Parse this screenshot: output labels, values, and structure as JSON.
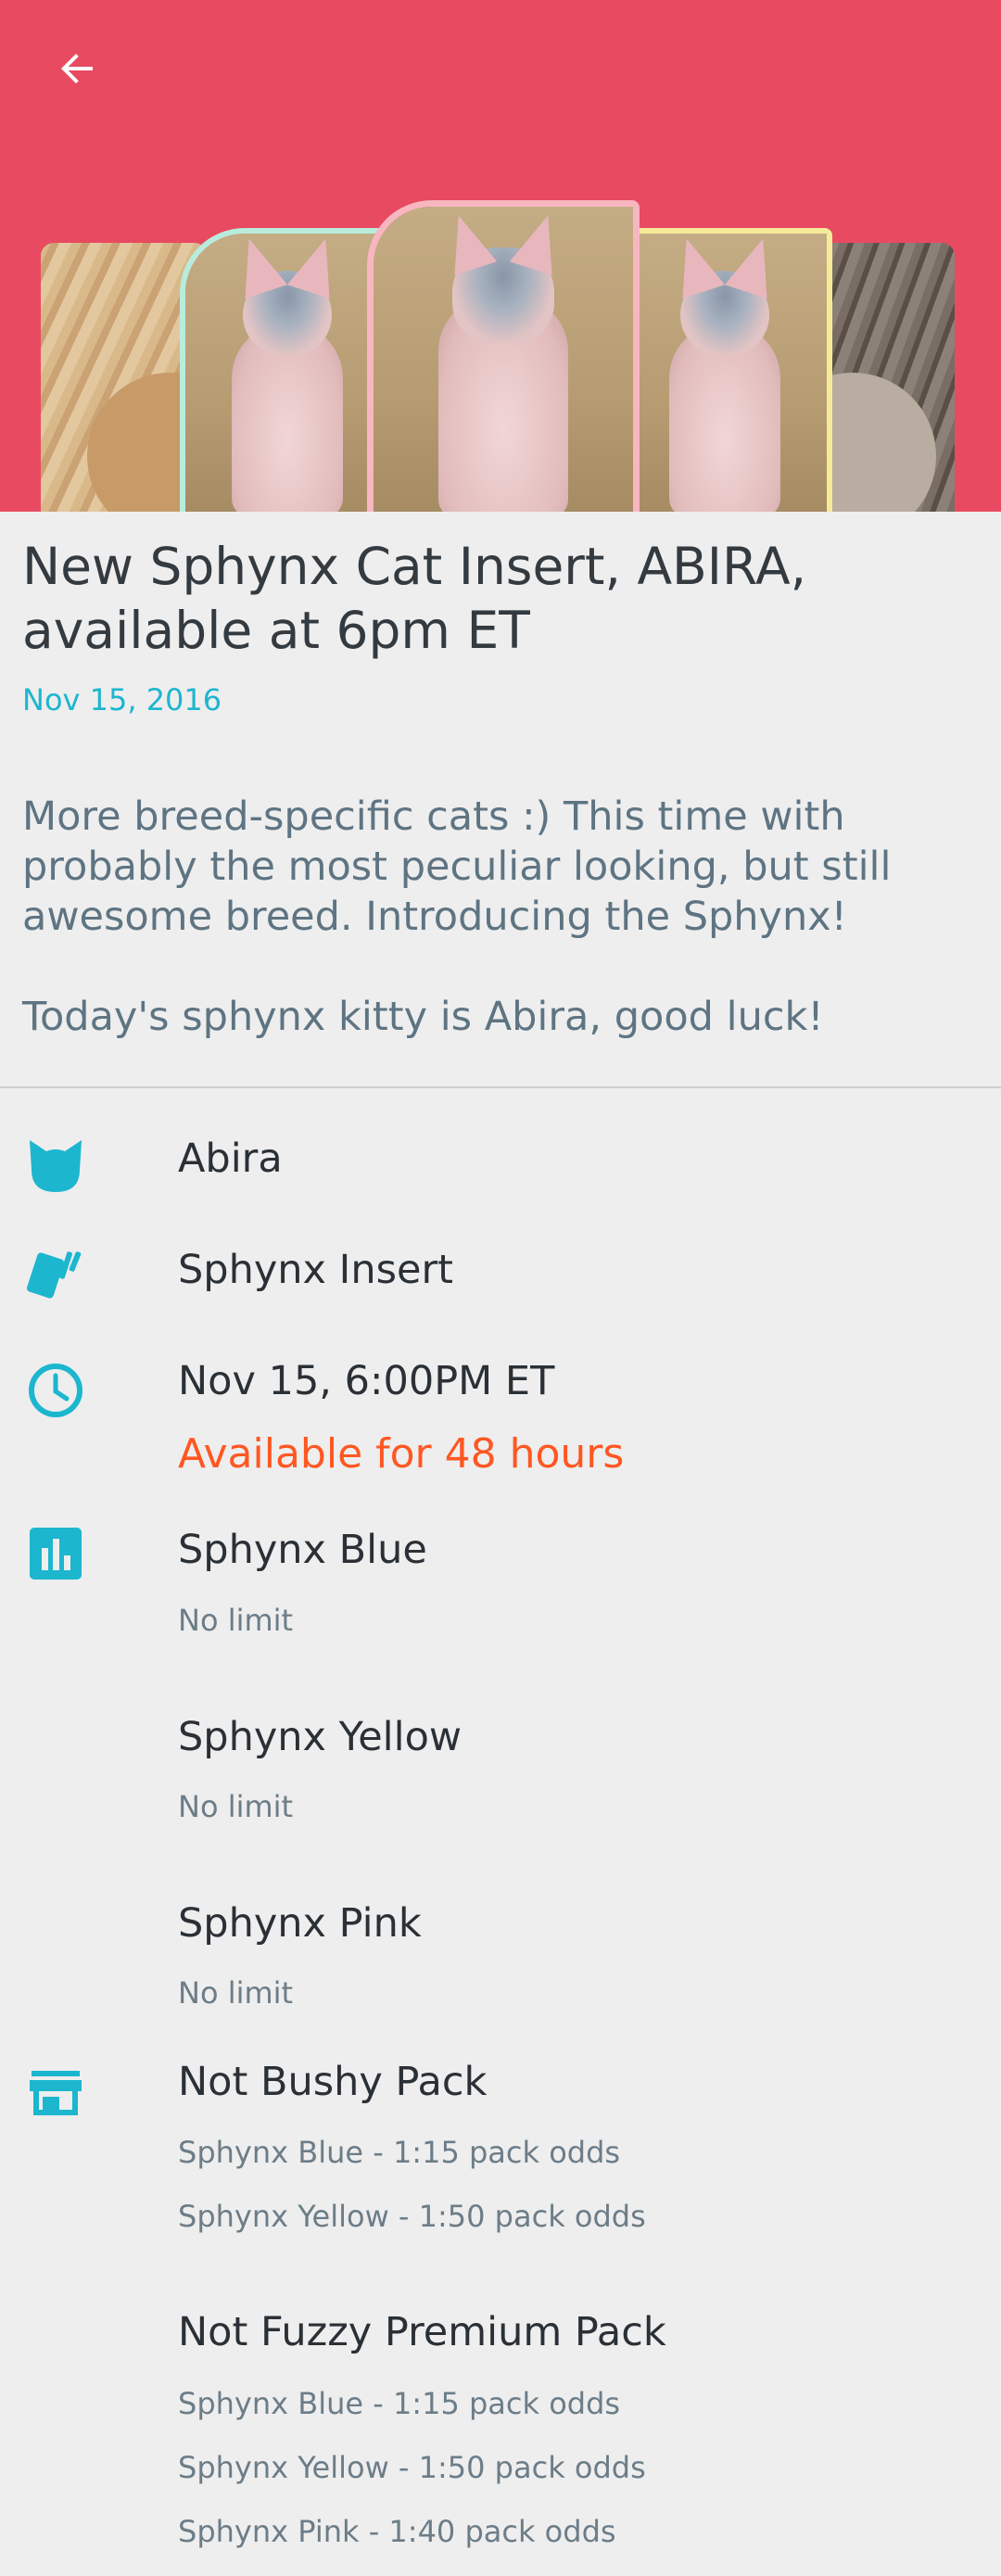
{
  "header": {
    "back_icon": "arrow-left-icon",
    "background": "#e84a61"
  },
  "post": {
    "title": "New Sphynx Cat Insert, ABIRA, available at 6pm ET",
    "date": "Nov 15, 2016",
    "description": "More breed-specific cats :) This time with probably the most peculiar looking, but still awesome breed. Introducing the Sphynx!\n\nToday's sphynx kitty is Abira, good luck!"
  },
  "details": {
    "cat_name": "Abira",
    "insert_name": "Sphynx Insert",
    "release_time": "Nov 15, 6:00PM ET",
    "availability": "Available for 48 hours",
    "variants": [
      {
        "name": "Sphynx Blue",
        "limit": "No limit"
      },
      {
        "name": "Sphynx Yellow",
        "limit": "No limit"
      },
      {
        "name": "Sphynx Pink",
        "limit": "No limit"
      }
    ],
    "packs": [
      {
        "name": "Not Bushy Pack",
        "odds": [
          "Sphynx Blue - 1:15 pack odds",
          "Sphynx Yellow - 1:50 pack odds"
        ]
      },
      {
        "name": "Not Fuzzy Premium Pack",
        "odds": [
          "Sphynx Blue - 1:15 pack odds",
          "Sphynx Yellow - 1:50 pack odds",
          "Sphynx Pink - 1:40 pack odds"
        ]
      }
    ]
  },
  "colors": {
    "accent": "#1cb6cf",
    "availability": "#ff5722",
    "card_blue_border": "#b8ecdc",
    "card_pink_border": "#f7b6c0",
    "card_yellow_border": "#f5ea9a"
  }
}
